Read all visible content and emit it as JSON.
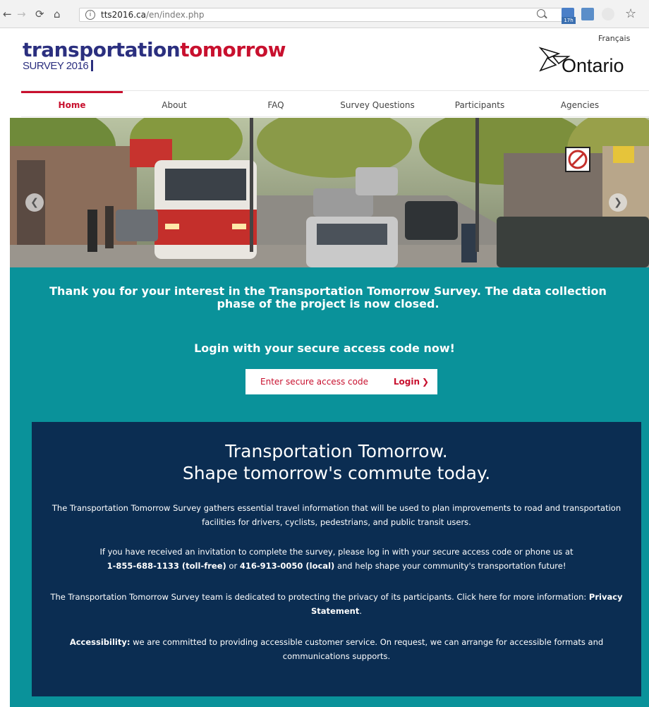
{
  "browser": {
    "url_domain": "tts2016.ca",
    "url_path": "/en/index.php",
    "extension_badge": "17h"
  },
  "header": {
    "logo_part1": "transportation",
    "logo_part2": "tomorrow",
    "logo_sub": "SURVEY 2016",
    "language_link": "Français",
    "ontario_text": "Ontario"
  },
  "nav": {
    "items": [
      {
        "label": "Home",
        "active": true
      },
      {
        "label": "About"
      },
      {
        "label": "FAQ"
      },
      {
        "label": "Survey Questions"
      },
      {
        "label": "Participants"
      },
      {
        "label": "Agencies"
      }
    ]
  },
  "hero": {
    "prev_icon": "chevron-left-icon",
    "next_icon": "chevron-right-icon"
  },
  "notice": {
    "thanks": "Thank you for your interest in the Transportation Tomorrow Survey. The data collection phase of the project is now closed.",
    "login_heading": "Login with your secure access code now!",
    "code_placeholder": "Enter secure access code",
    "login_label": "Login"
  },
  "info": {
    "title_line1": "Transportation Tomorrow.",
    "title_line2": "Shape tomorrow's commute today.",
    "p1": "The Transportation Tomorrow Survey gathers essential travel information that will be used to plan improvements to road and transportation facilities for drivers, cyclists, pedestrians, and public transit users.",
    "p2_intro": "If you have received an invitation to complete the survey, please log in with your secure access code or phone us at",
    "p2_phone_tollfree": "1-855-688-1133 (toll-free)",
    "p2_or": "or",
    "p2_phone_local": "416-913-0050 (local)",
    "p2_outro": "and help shape your community's transportation future!",
    "p3_intro": "The Transportation Tomorrow Survey team is dedicated to protecting the privacy of its participants. Click here for more information:",
    "p3_link": "Privacy Statement",
    "p4_label": "Accessibility:",
    "p4_text": "we are committed to providing accessible customer service. On request, we can arrange for accessible formats and communications supports."
  },
  "colors": {
    "brand_navy": "#2b2f7f",
    "brand_red": "#c8102e",
    "teal": "#0a929a",
    "dark_blue": "#0b2d52"
  }
}
